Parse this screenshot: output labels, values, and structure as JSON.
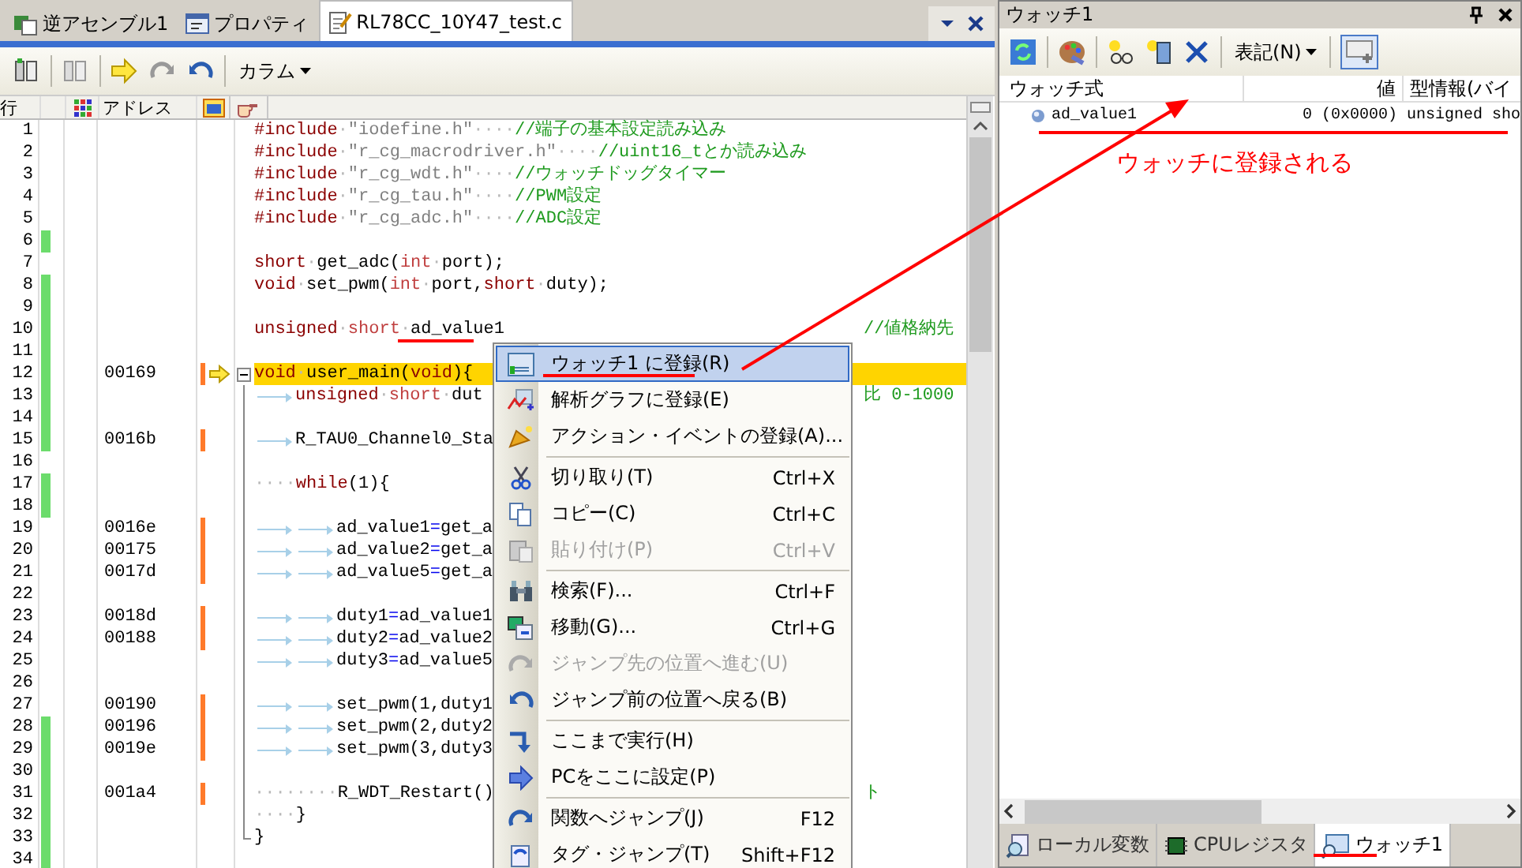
{
  "editor": {
    "tabs": [
      {
        "label": "逆アセンブル1",
        "selected": false
      },
      {
        "label": "プロパティ",
        "selected": false
      },
      {
        "label": "RL78CC_10Y47_test.c",
        "selected": true
      }
    ],
    "column_menu": "カラム",
    "header": {
      "line": "行",
      "address": "アドレス"
    },
    "lines": [
      {
        "no": "1",
        "kind": "code",
        "marked": false,
        "exec": false,
        "current": false,
        "segs": [
          {
            "kind": "kw",
            "text": "#include"
          },
          {
            "kind": "ws",
            "text": "·"
          },
          {
            "kind": "str",
            "text": "\"iodefine.h\""
          },
          {
            "kind": "ws",
            "text": "····"
          },
          {
            "kind": "cm",
            "text": "//端子の基本設定読み込み"
          }
        ]
      },
      {
        "no": "2",
        "kind": "code",
        "marked": false,
        "exec": false,
        "current": false,
        "segs": [
          {
            "kind": "kw",
            "text": "#include"
          },
          {
            "kind": "ws",
            "text": "·"
          },
          {
            "kind": "str",
            "text": "\"r_cg_macrodriver.h\""
          },
          {
            "kind": "ws",
            "text": "····"
          },
          {
            "kind": "cm",
            "text": "//uint16_tとか読み込み"
          }
        ]
      },
      {
        "no": "3",
        "kind": "code",
        "marked": false,
        "exec": false,
        "current": false,
        "segs": [
          {
            "kind": "kw",
            "text": "#include"
          },
          {
            "kind": "ws",
            "text": "·"
          },
          {
            "kind": "str",
            "text": "\"r_cg_wdt.h\""
          },
          {
            "kind": "ws",
            "text": "····"
          },
          {
            "kind": "cm",
            "text": "//ウォッチドッグタイマー"
          }
        ]
      },
      {
        "no": "4",
        "kind": "code",
        "marked": false,
        "exec": false,
        "current": false,
        "segs": [
          {
            "kind": "kw",
            "text": "#include"
          },
          {
            "kind": "ws",
            "text": "·"
          },
          {
            "kind": "str",
            "text": "\"r_cg_tau.h\""
          },
          {
            "kind": "ws",
            "text": "····"
          },
          {
            "kind": "cm",
            "text": "//PWM設定"
          }
        ]
      },
      {
        "no": "5",
        "kind": "code",
        "marked": false,
        "exec": false,
        "current": false,
        "segs": [
          {
            "kind": "kw",
            "text": "#include"
          },
          {
            "kind": "ws",
            "text": "·"
          },
          {
            "kind": "str",
            "text": "\"r_cg_adc.h\""
          },
          {
            "kind": "ws",
            "text": "····"
          },
          {
            "kind": "cm",
            "text": "//ADC設定"
          }
        ]
      },
      {
        "no": "6",
        "kind": "code",
        "marked": true,
        "exec": false,
        "current": false
      },
      {
        "no": "7",
        "kind": "code",
        "marked": false,
        "exec": false,
        "current": false,
        "segs": [
          {
            "kind": "kw",
            "text": "short"
          },
          {
            "kind": "ws",
            "text": "·"
          },
          {
            "kind": "plain",
            "text": "get_adc("
          },
          {
            "kind": "kw2",
            "text": "int"
          },
          {
            "kind": "ws",
            "text": "·"
          },
          {
            "kind": "plain",
            "text": "port);"
          }
        ]
      },
      {
        "no": "8",
        "kind": "code",
        "marked": true,
        "exec": false,
        "current": false,
        "segs": [
          {
            "kind": "kw",
            "text": "void"
          },
          {
            "kind": "ws",
            "text": "·"
          },
          {
            "kind": "plain",
            "text": "set_pwm("
          },
          {
            "kind": "kw2",
            "text": "int"
          },
          {
            "kind": "ws",
            "text": "·"
          },
          {
            "kind": "plain",
            "text": "port,"
          },
          {
            "kind": "kw",
            "text": "short"
          },
          {
            "kind": "ws",
            "text": "·"
          },
          {
            "kind": "plain",
            "text": "duty);"
          }
        ]
      },
      {
        "no": "9",
        "kind": "code",
        "marked": true,
        "exec": false,
        "current": false
      },
      {
        "no": "10",
        "kind": "code",
        "marked": true,
        "exec": false,
        "current": false,
        "segs": [
          {
            "kind": "kw",
            "text": "unsigned"
          },
          {
            "kind": "ws",
            "text": "·"
          },
          {
            "kind": "kw2",
            "text": "short"
          },
          {
            "kind": "ws",
            "text": "·"
          },
          {
            "kind": "plain",
            "text": "ad_value1"
          }
        ],
        "tail": "//値格納先"
      },
      {
        "no": "11",
        "kind": "code",
        "marked": true,
        "exec": false,
        "current": false
      },
      {
        "no": "12",
        "addr": "00169",
        "kind": "fold-start",
        "marked": true,
        "exec": true,
        "current": true,
        "segs": [
          {
            "kind": "kw",
            "text": "void"
          },
          {
            "kind": "ws",
            "text": "·"
          },
          {
            "kind": "plain",
            "text": "user_main("
          },
          {
            "kind": "kw",
            "text": "void"
          },
          {
            "kind": "plain",
            "text": "){"
          }
        ]
      },
      {
        "no": "13",
        "kind": "fold-body",
        "marked": true,
        "exec": false,
        "current": false,
        "segs": [
          {
            "kind": "tab"
          },
          {
            "kind": "kw",
            "text": "unsigned"
          },
          {
            "kind": "ws",
            "text": "·"
          },
          {
            "kind": "kw2",
            "text": "short"
          },
          {
            "kind": "ws",
            "text": "·"
          },
          {
            "kind": "plain",
            "text": "dut"
          }
        ],
        "tail": "比 0-1000"
      },
      {
        "no": "14",
        "kind": "fold-body",
        "marked": true,
        "exec": false,
        "current": false
      },
      {
        "no": "15",
        "addr": "0016b",
        "kind": "fold-body",
        "marked": true,
        "exec": true,
        "current": false,
        "segs": [
          {
            "kind": "tab"
          },
          {
            "kind": "plain",
            "text": "R_TAU0_Channel0_Sta"
          }
        ]
      },
      {
        "no": "16",
        "kind": "fold-body",
        "marked": false,
        "exec": false,
        "current": false
      },
      {
        "no": "17",
        "kind": "fold-body",
        "marked": true,
        "exec": false,
        "current": false,
        "segs": [
          {
            "kind": "ws",
            "text": "····"
          },
          {
            "kind": "kw",
            "text": "while"
          },
          {
            "kind": "plain",
            "text": "(1){"
          }
        ]
      },
      {
        "no": "18",
        "kind": "fold-body",
        "marked": true,
        "exec": false,
        "current": false
      },
      {
        "no": "19",
        "addr": "0016e",
        "kind": "fold-body",
        "marked": false,
        "exec": true,
        "current": false,
        "segs": [
          {
            "kind": "tab"
          },
          {
            "kind": "tab"
          },
          {
            "kind": "plain",
            "text": "ad_value1"
          },
          {
            "kind": "op",
            "text": "="
          },
          {
            "kind": "plain",
            "text": "get_a"
          }
        ]
      },
      {
        "no": "20",
        "addr": "00175",
        "kind": "fold-body",
        "marked": false,
        "exec": true,
        "current": false,
        "segs": [
          {
            "kind": "tab"
          },
          {
            "kind": "tab"
          },
          {
            "kind": "plain",
            "text": "ad_value2"
          },
          {
            "kind": "op",
            "text": "="
          },
          {
            "kind": "plain",
            "text": "get_a"
          }
        ]
      },
      {
        "no": "21",
        "addr": "0017d",
        "kind": "fold-body",
        "marked": false,
        "exec": true,
        "current": false,
        "segs": [
          {
            "kind": "tab"
          },
          {
            "kind": "tab"
          },
          {
            "kind": "plain",
            "text": "ad_value5"
          },
          {
            "kind": "op",
            "text": "="
          },
          {
            "kind": "plain",
            "text": "get_a"
          }
        ]
      },
      {
        "no": "22",
        "kind": "fold-body",
        "marked": false,
        "exec": false,
        "current": false
      },
      {
        "no": "23",
        "addr": "0018d",
        "kind": "fold-body",
        "marked": false,
        "exec": true,
        "current": false,
        "segs": [
          {
            "kind": "tab"
          },
          {
            "kind": "tab"
          },
          {
            "kind": "plain",
            "text": "duty1"
          },
          {
            "kind": "op",
            "text": "="
          },
          {
            "kind": "plain",
            "text": "ad_value1"
          }
        ]
      },
      {
        "no": "24",
        "addr": "00188",
        "kind": "fold-body",
        "marked": false,
        "exec": true,
        "current": false,
        "segs": [
          {
            "kind": "tab"
          },
          {
            "kind": "tab"
          },
          {
            "kind": "plain",
            "text": "duty2"
          },
          {
            "kind": "op",
            "text": "="
          },
          {
            "kind": "plain",
            "text": "ad_value2"
          }
        ]
      },
      {
        "no": "25",
        "kind": "fold-body",
        "marked": false,
        "exec": false,
        "current": false,
        "segs": [
          {
            "kind": "tab"
          },
          {
            "kind": "tab"
          },
          {
            "kind": "plain",
            "text": "duty3"
          },
          {
            "kind": "op",
            "text": "="
          },
          {
            "kind": "plain",
            "text": "ad_value5"
          }
        ]
      },
      {
        "no": "26",
        "kind": "fold-body",
        "marked": false,
        "exec": false,
        "current": false
      },
      {
        "no": "27",
        "addr": "00190",
        "kind": "fold-body",
        "marked": false,
        "exec": true,
        "current": false,
        "segs": [
          {
            "kind": "tab"
          },
          {
            "kind": "tab"
          },
          {
            "kind": "plain",
            "text": "set_pwm(1,duty1"
          }
        ]
      },
      {
        "no": "28",
        "addr": "00196",
        "kind": "fold-body",
        "marked": true,
        "exec": true,
        "current": false,
        "segs": [
          {
            "kind": "tab"
          },
          {
            "kind": "tab"
          },
          {
            "kind": "plain",
            "text": "set_pwm(2,duty2"
          }
        ]
      },
      {
        "no": "29",
        "addr": "0019e",
        "kind": "fold-body",
        "marked": true,
        "exec": true,
        "current": false,
        "segs": [
          {
            "kind": "tab"
          },
          {
            "kind": "tab"
          },
          {
            "kind": "plain",
            "text": "set_pwm(3,duty3"
          }
        ]
      },
      {
        "no": "30",
        "kind": "fold-body",
        "marked": true,
        "exec": false,
        "current": false
      },
      {
        "no": "31",
        "addr": "001a4",
        "kind": "fold-body",
        "marked": true,
        "exec": true,
        "current": false,
        "segs": [
          {
            "kind": "ws",
            "text": "········"
          },
          {
            "kind": "plain",
            "text": "R_WDT_Restart()"
          }
        ],
        "tail": "ト"
      },
      {
        "no": "32",
        "kind": "fold-body",
        "marked": true,
        "exec": false,
        "current": false,
        "segs": [
          {
            "kind": "ws",
            "text": "····"
          },
          {
            "kind": "plain",
            "text": "}"
          }
        ]
      },
      {
        "no": "33",
        "kind": "fold-end",
        "marked": true,
        "exec": false,
        "current": false,
        "segs": [
          {
            "kind": "plain",
            "text": "}"
          }
        ]
      },
      {
        "no": "34",
        "kind": "code",
        "marked": true,
        "exec": false,
        "current": false
      }
    ]
  },
  "context_menu": {
    "items": [
      {
        "kind": "item",
        "label": "ウォッチ1 に登録(R)",
        "selected": true,
        "disabled": false
      },
      {
        "kind": "item",
        "label": "解析グラフに登録(E)",
        "selected": false,
        "disabled": false
      },
      {
        "kind": "item",
        "label": "アクション・イベントの登録(A)...",
        "selected": false,
        "disabled": false
      },
      {
        "kind": "separator"
      },
      {
        "kind": "item",
        "label": "切り取り(T)",
        "shortcut": "Ctrl+X",
        "selected": false,
        "disabled": false
      },
      {
        "kind": "item",
        "label": "コピー(C)",
        "shortcut": "Ctrl+C",
        "selected": false,
        "disabled": false
      },
      {
        "kind": "item",
        "label": "貼り付け(P)",
        "shortcut": "Ctrl+V",
        "selected": false,
        "disabled": true
      },
      {
        "kind": "separator"
      },
      {
        "kind": "item",
        "label": "検索(F)...",
        "shortcut": "Ctrl+F",
        "selected": false,
        "disabled": false
      },
      {
        "kind": "item",
        "label": "移動(G)...",
        "shortcut": "Ctrl+G",
        "selected": false,
        "disabled": false
      },
      {
        "kind": "item",
        "label": "ジャンプ先の位置へ進む(U)",
        "selected": false,
        "disabled": true
      },
      {
        "kind": "item",
        "label": "ジャンプ前の位置へ戻る(B)",
        "selected": false,
        "disabled": false
      },
      {
        "kind": "separator"
      },
      {
        "kind": "item",
        "label": "ここまで実行(H)",
        "selected": false,
        "disabled": false
      },
      {
        "kind": "item",
        "label": "PCをここに設定(P)",
        "selected": false,
        "disabled": false
      },
      {
        "kind": "separator"
      },
      {
        "kind": "item",
        "label": "関数へジャンプ(J)",
        "shortcut": "F12",
        "selected": false,
        "disabled": false
      },
      {
        "kind": "item",
        "label": "タグ・ジャンプ(T)",
        "shortcut": "Shift+F12",
        "selected": false,
        "disabled": false
      }
    ]
  },
  "watch_panel": {
    "title": "ウォッチ1",
    "notation_menu": "表記(N)",
    "columns": [
      "ウォッチ式",
      "値",
      "型情報(バイ"
    ],
    "rows": [
      {
        "name": "ad_value1",
        "value": "0 (0x0000)",
        "type": "unsigned sho"
      }
    ],
    "tabs": [
      {
        "label": "ローカル変数",
        "selected": false
      },
      {
        "label": "CPUレジスタ",
        "selected": false
      },
      {
        "label": "ウォッチ1",
        "selected": true
      }
    ]
  },
  "annotation": {
    "text": "ウォッチに登録される"
  }
}
